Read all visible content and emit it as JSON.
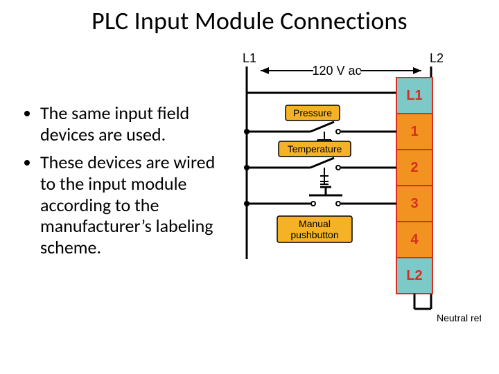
{
  "title": "PLC Input Module Connections",
  "bullets": [
    "The same input field devices are used.",
    "These devices are wired to the input module according to the manufacturer’s labeling scheme."
  ],
  "diagram": {
    "rails": {
      "left": "L1",
      "right": "L2"
    },
    "voltage": "120 V ac",
    "inputs": [
      {
        "label": "Pressure"
      },
      {
        "label": "Temperature"
      },
      {
        "label": "Manual pushbutton"
      }
    ],
    "module_slots": [
      "L1",
      "1",
      "2",
      "3",
      "4",
      "L2"
    ],
    "neutral": "Neutral return",
    "colors": {
      "tag": "#F6B227",
      "slot_input": "#F29220",
      "slot_rail": "#7CC9C8",
      "slot_border": "#D62E1F"
    }
  }
}
